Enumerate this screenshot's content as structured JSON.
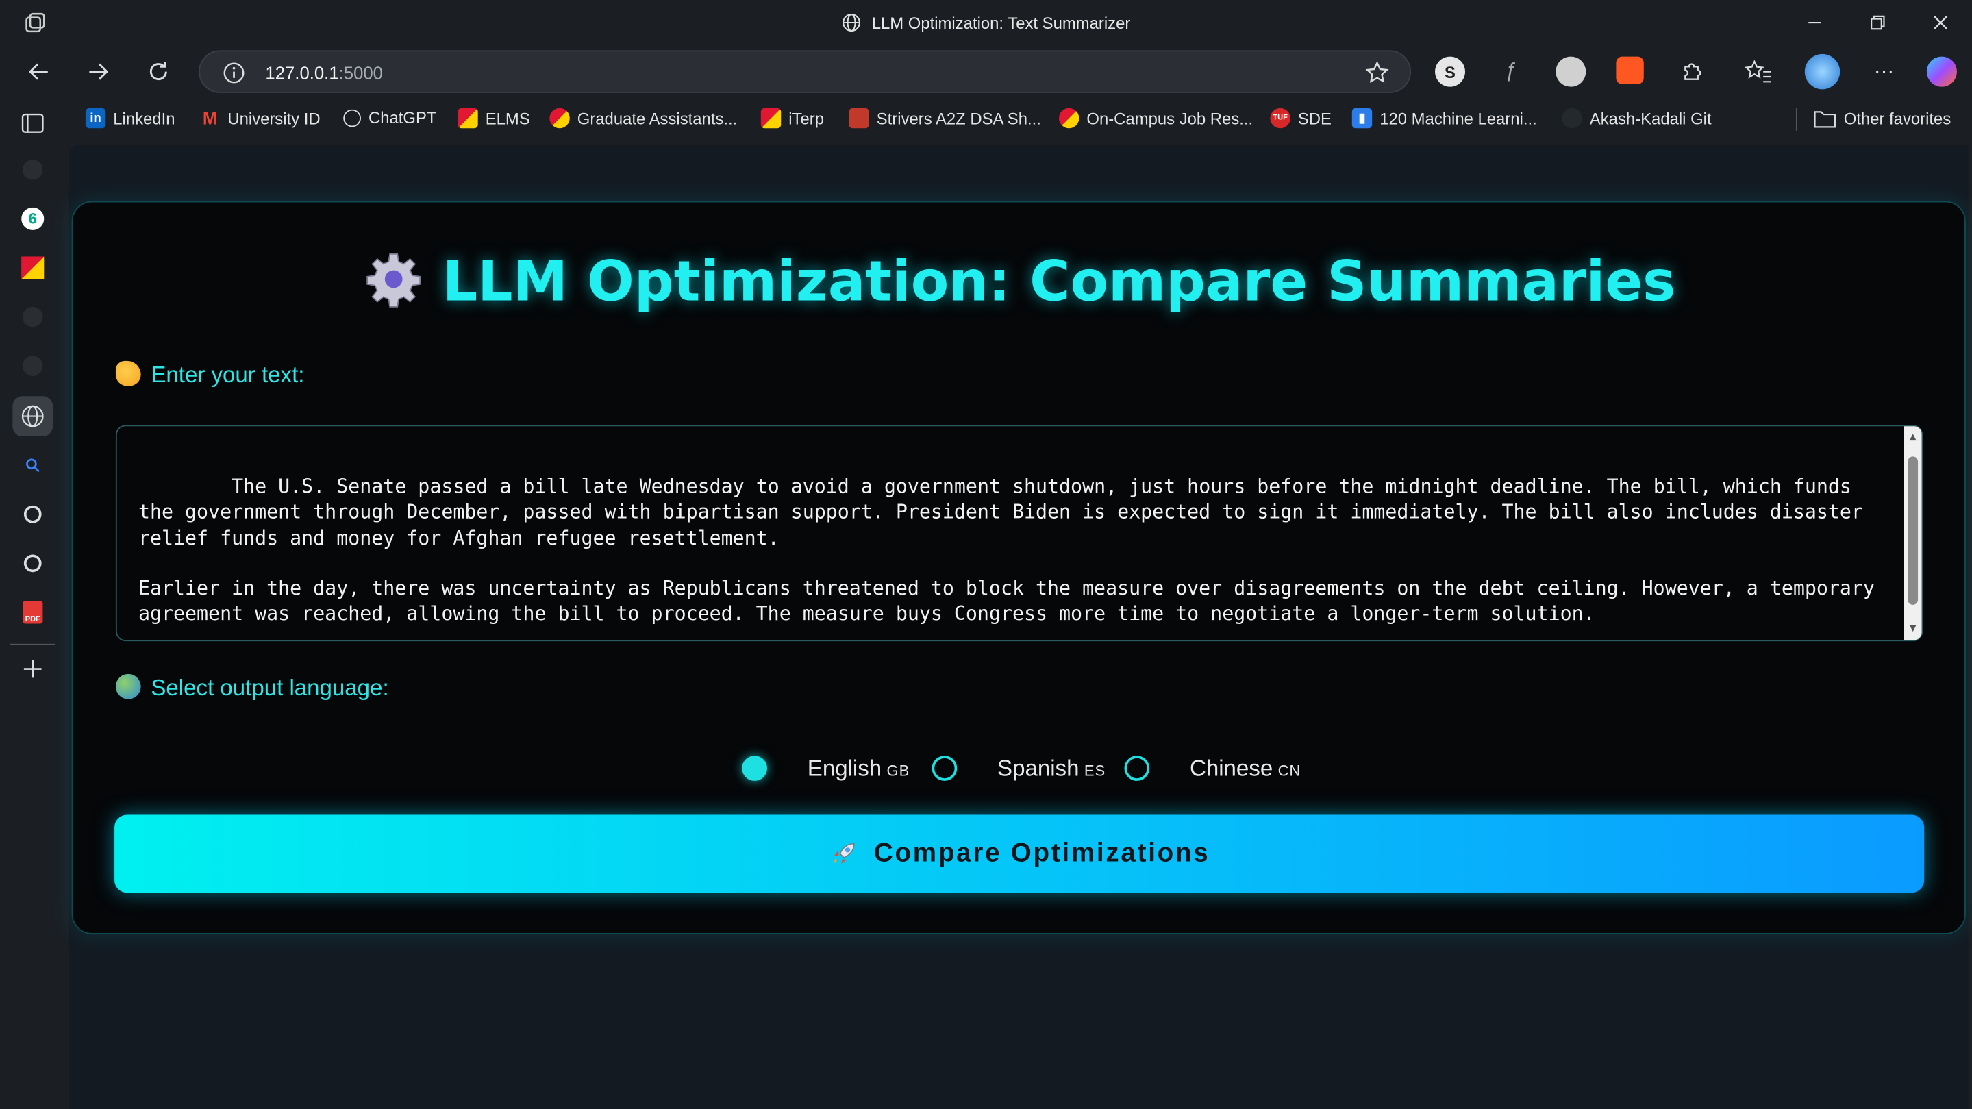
{
  "window": {
    "title": "LLM Optimization: Text Summarizer"
  },
  "address_bar": {
    "host": "127.0.0.1",
    "port": ":5000"
  },
  "favorites": [
    {
      "label": "LinkedIn",
      "icon": "linkedin-icon",
      "color": "#0a66c2"
    },
    {
      "label": "University ID",
      "icon": "gmail-icon",
      "color": "#ea4335"
    },
    {
      "label": "ChatGPT",
      "icon": "openai-icon",
      "color": "#e8e8e8"
    },
    {
      "label": "ELMS",
      "icon": "umd-icon",
      "color": "#e21833"
    },
    {
      "label": "Graduate Assistants...",
      "icon": "umd-icon",
      "color": "#e21833"
    },
    {
      "label": "iTerp",
      "icon": "umd-icon",
      "color": "#e21833"
    },
    {
      "label": "Strivers A2Z DSA Sh...",
      "icon": "tuf-icon",
      "color": "#c0392b"
    },
    {
      "label": "On-Campus Job Res...",
      "icon": "umd-icon",
      "color": "#e21833"
    },
    {
      "label": "SDE",
      "icon": "tuf-icon",
      "color": "#d62828"
    },
    {
      "label": "120 Machine Learni...",
      "icon": "chart-icon",
      "color": "#2b7de9"
    },
    {
      "label": "Akash-Kadali Git",
      "icon": "github-icon",
      "color": "#24292e"
    }
  ],
  "other_favorites": "Other favorites",
  "page": {
    "heading": "LLM Optimization: Compare Summaries",
    "text_label": "Enter your text:",
    "text_value": "The U.S. Senate passed a bill late Wednesday to avoid a government shutdown, just hours before the midnight deadline. The bill, which funds the government through December, passed with bipartisan support. President Biden is expected to sign it immediately. The bill also includes disaster relief funds and money for Afghan refugee resettlement.\n\nEarlier in the day, there was uncertainty as Republicans threatened to block the measure over disagreements on the debt ceiling. However, a temporary agreement was reached, allowing the bill to proceed. The measure buys Congress more time to negotiate a longer-term solution.",
    "language_label": "Select output language:",
    "languages": [
      {
        "name": "English",
        "code": "GB",
        "selected": true
      },
      {
        "name": "Spanish",
        "code": "ES",
        "selected": false
      },
      {
        "name": "Chinese",
        "code": "CN",
        "selected": false
      }
    ],
    "submit_label": "Compare Optimizations",
    "accent_color": "#22f0f0"
  }
}
